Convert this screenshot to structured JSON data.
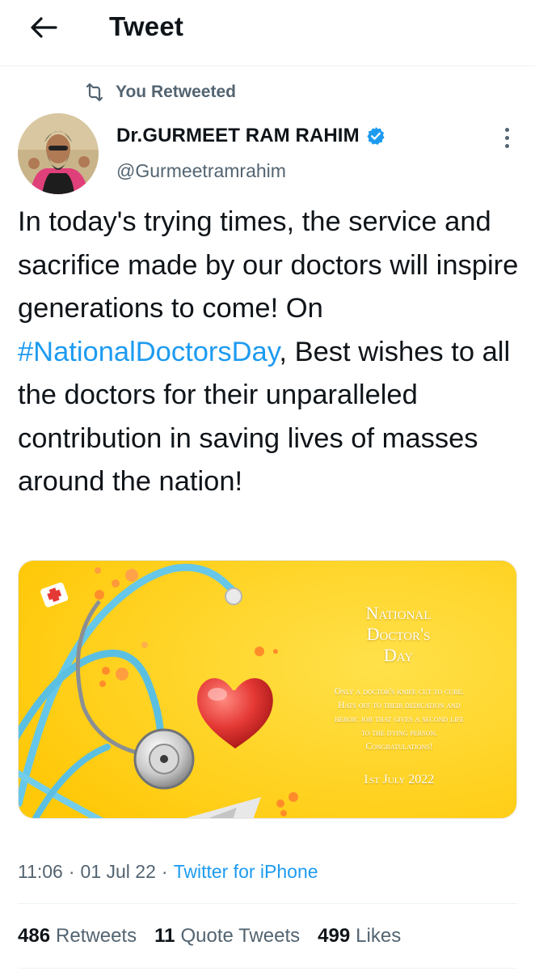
{
  "header": {
    "title": "Tweet"
  },
  "retweet": {
    "label": "You Retweeted"
  },
  "author": {
    "display_name": "Dr.GURMEET RAM RAHIM",
    "handle": "@Gurmeetramrahim",
    "verified": true
  },
  "tweet": {
    "text_before": "In today's trying times, the service and sacrifice made by our doctors will inspire generations to come! On ",
    "hashtag": "#NationalDoctorsDay",
    "text_after": ", Best wishes to all the doctors for their unparalleled contribution in saving lives of masses around the nation!"
  },
  "media": {
    "title_line1": "National",
    "title_line2": "Doctor's",
    "title_line3": "Day",
    "message_line1": "Only a doctor's knife cut to cure.",
    "message_line2": "Hats off to their dedication and",
    "message_line3": "heroic job that gives a second life",
    "message_line4": "to the dying person.",
    "message_line5": "Congratulations!",
    "date": "1st July 2022"
  },
  "meta": {
    "time": "11:06",
    "date": "01 Jul 22",
    "separator": "·",
    "source": "Twitter for iPhone"
  },
  "stats": {
    "retweets_count": "486",
    "retweets_label": "Retweets",
    "quotes_count": "11",
    "quotes_label": "Quote Tweets",
    "likes_count": "499",
    "likes_label": "Likes"
  },
  "colors": {
    "accent": "#1d9bf0",
    "secondary_text": "#536471",
    "primary_text": "#0f1419",
    "media_bg": "#ffd21a"
  }
}
